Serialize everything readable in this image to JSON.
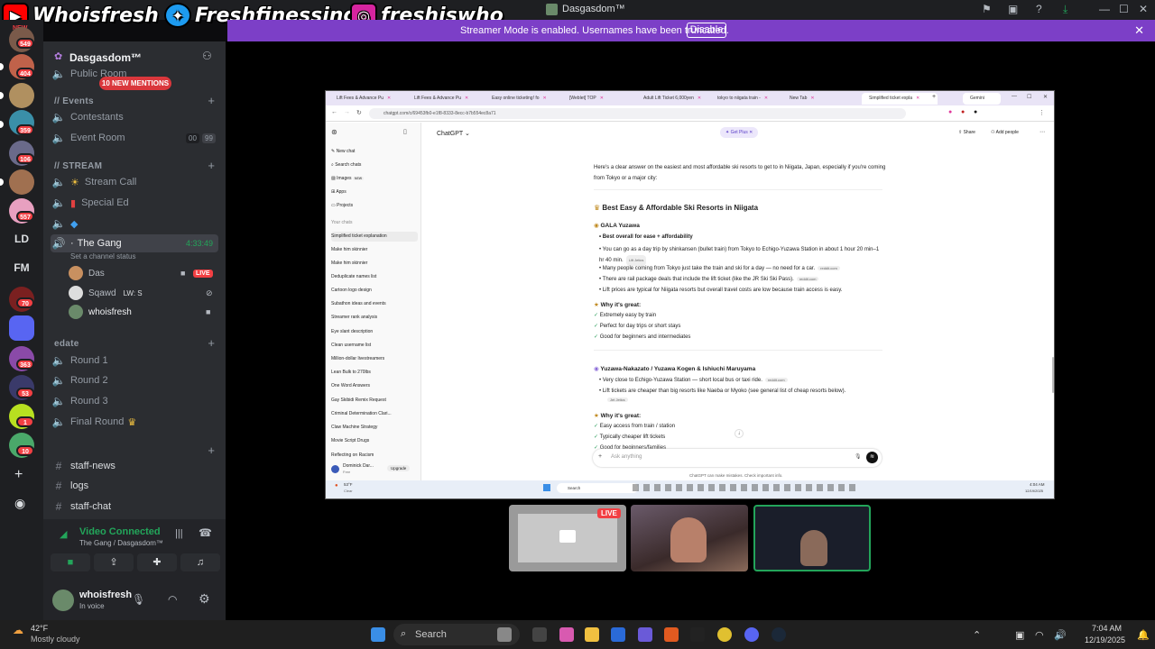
{
  "window": {
    "title": "Dasgasdom™"
  },
  "overlay": {
    "youtube": "Whoisfresh",
    "twitter": "Freshfinessing",
    "instagram": "freshiswho_"
  },
  "streamer_bar": {
    "message": "Streamer Mode is enabled. Usernames have been truncated.",
    "button": "Disable",
    "color": "#7c3fc7"
  },
  "rail": {
    "badges": [
      "549",
      "404",
      "359",
      "106",
      "557",
      "70",
      "363",
      "53",
      "1",
      "10"
    ],
    "texts": [
      "LD",
      "FM"
    ],
    "new_label": "NEW"
  },
  "server": {
    "name": "Dasgasdom™",
    "mentions": "10 NEW MENTIONS"
  },
  "channels": {
    "public_room": "Public Room",
    "events_cat": "// Events",
    "contestants": "Contestants",
    "event_room": "Event Room",
    "event_room_count_a": "00",
    "event_room_count_b": "99",
    "stream_cat": "// STREAM",
    "stream_call": "Stream Call",
    "special_ed": "Special Ed",
    "the_gang": "The Gang",
    "the_gang_time": "4:33:49",
    "channel_status": "Set a channel status",
    "voice_users": [
      {
        "name": "Das",
        "badge": "LIVE"
      },
      {
        "name": "Sqawd",
        "extra": "LW: S"
      },
      {
        "name": "whoisfresh"
      }
    ],
    "edate_cat": "edate",
    "rounds": [
      "Round 1",
      "Round 2",
      "Round 3",
      "Final Round"
    ],
    "text_channels": [
      "staff-news",
      "logs",
      "staff-chat"
    ]
  },
  "voice": {
    "status": "Video Connected",
    "location": "The Gang / Dasgasdom™"
  },
  "user": {
    "name": "whoisfresh",
    "status": "In voice"
  },
  "browser": {
    "tabs": [
      "Lift Fees & Advance Pu",
      "Lift Fees & Advance Pu",
      "Easy online ticketing! fo",
      "[Weblet] TOP",
      "Adult Lift Ticket 6,000yen",
      "tokyo to niigata train -",
      "New Tab",
      "Simplified ticket expla",
      "Gemini"
    ],
    "url": "chatgpt.com/c/69453fb0-e1f8-8333-8ecc-b7b554ec8a71",
    "app_title": "ChatGPT",
    "get_plus": "Get Plus",
    "share": "Share",
    "add_people": "Add people",
    "side_top": [
      "New chat",
      "Search chats",
      "Images",
      "Apps",
      "Projects"
    ],
    "images_badge": "NEW",
    "your_chats": "Your chats",
    "chats": [
      "Simplified ticket explanation",
      "Make him skinnier",
      "Make him skinnier",
      "Deduplicate names list",
      "Cartoon logo design",
      "Subathon ideas and events",
      "Streamer rank analysis",
      "Eye slant description",
      "Clean username list",
      "Million-dollar livestreamers",
      "Lean Bulk to 270lbs",
      "One Word Answers",
      "Gay Skibidi Remix Request",
      "Criminal Determination Clari...",
      "Claw Machine Strategy",
      "Movie Script Drugs",
      "Reflecting on Racism"
    ],
    "account_name": "Dominick Dar...",
    "account_plan": "Free",
    "upgrade": "Upgrade",
    "intro": "Here's a clear answer on the easiest and most affordable ski resorts to get to in Niigata, Japan, especially if you're coming from Tokyo or a major city:",
    "heading": "Best Easy & Affordable Ski Resorts in Niigata",
    "resort1": "GALA Yuzawa",
    "r1_bullets": [
      "Best overall for ease + affordability",
      "You can go as a day trip by shinkansen (bullet train) from Tokyo to Echigo-Yuzawa Station in about 1 hour 20 min–1 hr 40 min.",
      "Many people coming from Tokyo just take the train and ski for a day — no need for a car.",
      "There are rail package deals that include the lift ticket (like the JR Ski Ski Pass).",
      "Lift prices are typical for Niigata resorts but overall travel costs are low because train access is easy."
    ],
    "why_great": "Why it's great:",
    "r1_checks": [
      "Extremely easy by train",
      "Perfect for day trips or short stays",
      "Good for beginners and intermediates"
    ],
    "resort2": "Yuzawa-Nakazato / Yuzawa Kogen & Ishiuchi Maruyama",
    "r2_bullets": [
      "Very close to Echigo-Yuzawa Station — short local bus or taxi ride.",
      "Lift tickets are cheaper than big resorts like Naeba or Myoko (see general list of cheap resorts below)."
    ],
    "r2_checks": [
      "Easy access from train / station",
      "Typically cheaper lift tickets",
      "Good for beginners/families"
    ],
    "citations": [
      "Lift Jetics",
      "reddit.com",
      "reddit.com",
      "reddit.com",
      "Jet Jetics"
    ],
    "composer_placeholder": "Ask anything",
    "disclaimer": "ChatGPT can make mistakes. Check important info.",
    "taskbar_weather": "53°F",
    "taskbar_weather_sub": "Clear",
    "taskbar_search": "Search",
    "taskbar_time": "4:04 AM",
    "taskbar_date": "12/19/2025"
  },
  "tiles": {
    "live": "LIVE"
  },
  "taskbar": {
    "weather_temp": "42°F",
    "weather_desc": "Mostly cloudy",
    "search": "Search",
    "time": "7:04 AM",
    "date": "12/19/2025"
  }
}
